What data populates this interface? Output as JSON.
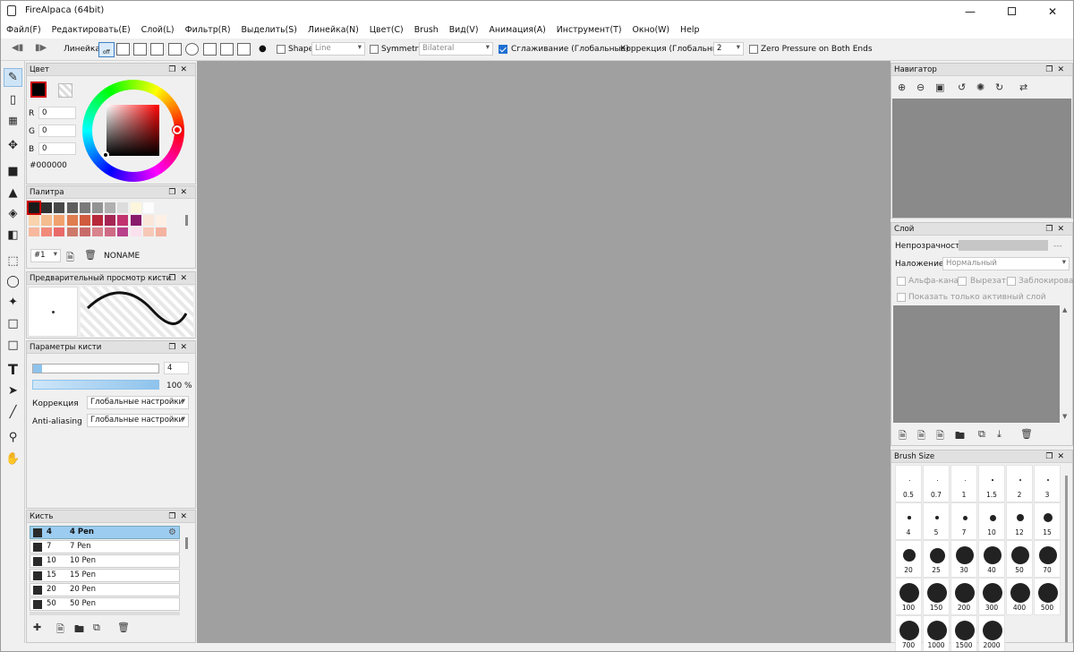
{
  "window": {
    "title": "FireAlpaca (64bit)",
    "minimize_icon": "minimize-icon",
    "maximize_icon": "maximize-icon",
    "close_icon": "close-icon"
  },
  "menu": [
    "Файл(F)",
    "Редактировать(E)",
    "Слой(L)",
    "Фильтр(R)",
    "Выделить(S)",
    "Линейка(N)",
    "Цвет(C)",
    "Brush",
    "Вид(V)",
    "Анимация(A)",
    "Инструмент(T)",
    "Окно(W)",
    "Help"
  ],
  "toolbar": {
    "ruler_label": "Линейка",
    "ruler_off": "off",
    "shape_label": "Shape",
    "shape_value": "Line",
    "symmetry_label": "Symmetry",
    "symmetry_value": "Bilateral",
    "smoothing_label": "Сглаживание (Глобальные)",
    "correction_label": "Коррекция (Глобальные)",
    "correction_value": "2",
    "zero_pressure_label": "Zero Pressure on Both Ends"
  },
  "color_panel": {
    "title": "Цвет",
    "r_label": "R",
    "r_value": "0",
    "g_label": "G",
    "g_value": "0",
    "b_label": "B",
    "b_value": "0",
    "hex": "#000000"
  },
  "palette_panel": {
    "title": "Палитра",
    "index": "#1",
    "name": "NONAME",
    "row1": [
      "#1a1a1a",
      "#303030",
      "#484848",
      "#5e5e5e",
      "#7a7a7a",
      "#939393",
      "#b0b0b0",
      "#dcdcdc",
      "#fdf6dc",
      "#fcfcfc"
    ],
    "row2": [
      "#f8d3ad",
      "#f5bc8e",
      "#f0a16e",
      "#e07d4f",
      "#d05a3e",
      "#b8283b",
      "#a52553",
      "#c0336e",
      "#8a1a6c",
      "#fbe7da",
      "#fff0e6"
    ],
    "row3": [
      "#f7b89d",
      "#f28a7a",
      "#ea6a6a",
      "#cd7a6a",
      "#c96a6a",
      "#d9838d",
      "#cf6a84",
      "#b9408a",
      "#fbe1ee",
      "#f7c8b8",
      "#f4b2a0"
    ]
  },
  "brush_preview_panel": {
    "title": "Предварительный просмотр кисти"
  },
  "brush_params_panel": {
    "title": "Параметры кисти",
    "size_value": "4",
    "opacity_value": "100 %",
    "opacity_fraction": 1.0,
    "correction_label": "Коррекция",
    "correction_value": "Глобальные настройки",
    "antialias_label": "Anti-aliasing",
    "antialias_value": "Глобальные настройки"
  },
  "brush_panel": {
    "title": "Кисть",
    "items": [
      {
        "size": "4",
        "name": "4  Pen"
      },
      {
        "size": "7",
        "name": "7 Pen"
      },
      {
        "size": "10",
        "name": "10 Pen"
      },
      {
        "size": "15",
        "name": "15 Pen"
      },
      {
        "size": "20",
        "name": "20 Pen"
      },
      {
        "size": "50",
        "name": "50 Pen"
      }
    ]
  },
  "navigator_panel": {
    "title": "Навигатор"
  },
  "layer_panel": {
    "title": "Слой",
    "opacity_label": "Непрозрачность",
    "opacity_value": "---",
    "blend_label": "Наложение",
    "blend_value": "Нормальный",
    "alpha_label": "Альфа-кана.",
    "clip_label": "Вырезати",
    "lock_label": "Заблокировати",
    "active_only_label": "Показать только активный слой"
  },
  "brush_size_panel": {
    "title": "Brush Size",
    "sizes": [
      "0.5",
      "0.7",
      "1",
      "1.5",
      "2",
      "3",
      "4",
      "5",
      "7",
      "10",
      "12",
      "15",
      "20",
      "25",
      "30",
      "40",
      "50",
      "70",
      "100",
      "150",
      "200",
      "300",
      "400",
      "500",
      "700",
      "1000",
      "1500",
      "2000"
    ]
  },
  "colors": {
    "accent": "#1f6fd1",
    "canvas_bg": "#a0a0a0",
    "nav_bg": "#8a8a8a",
    "brush_selected": "#9cccf0"
  }
}
